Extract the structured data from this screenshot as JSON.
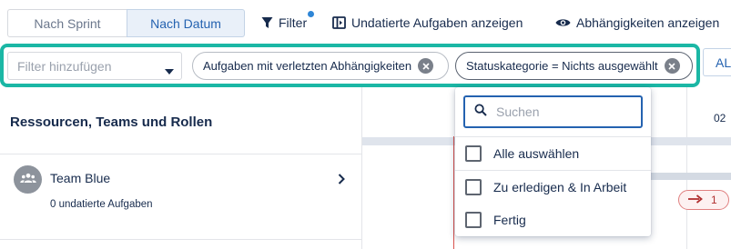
{
  "toolbar": {
    "view_toggle": {
      "by_sprint": "Nach Sprint",
      "by_date": "Nach Datum",
      "selected": "Nach Datum"
    },
    "filter_label": "Filter",
    "undated_tasks_label": "Undatierte Aufgaben anzeigen",
    "dependencies_label": "Abhängigkeiten anzeigen"
  },
  "filter_bar": {
    "input_placeholder": "Filter hinzufügen",
    "chips": [
      {
        "label": "Aufgaben mit verletzten Abhängigkeiten"
      },
      {
        "label": "Statuskategorie = Nichts ausgewählt"
      }
    ],
    "overflow_label": "AL"
  },
  "resources_panel": {
    "title": "Ressourcen, Teams und Rollen",
    "team": {
      "name": "Team Blue",
      "undated_count_label": "0 undatierte Aufgaben"
    }
  },
  "timeline": {
    "date_label": "02",
    "dependency_badge_count": "1"
  },
  "status_dropdown": {
    "search_placeholder": "Suchen",
    "select_all_label": "Alle auswählen",
    "options": [
      {
        "label": "Zu erledigen & In Arbeit",
        "checked": false
      },
      {
        "label": "Fertig",
        "checked": false
      }
    ]
  },
  "colors": {
    "accent_teal": "#1bb7a5",
    "primary_blue": "#2462b0",
    "today_line_red": "#d9534f",
    "notification_dot": "#2f86d6"
  },
  "icons": {
    "filter": "filter-icon",
    "undated_tasks": "panel-icon",
    "dependencies": "eye-icon",
    "team": "team-icon",
    "search": "search-icon",
    "chip_remove": "close-icon",
    "expand": "chevron-right-icon",
    "dependency_arrow": "arrow-right-icon"
  }
}
